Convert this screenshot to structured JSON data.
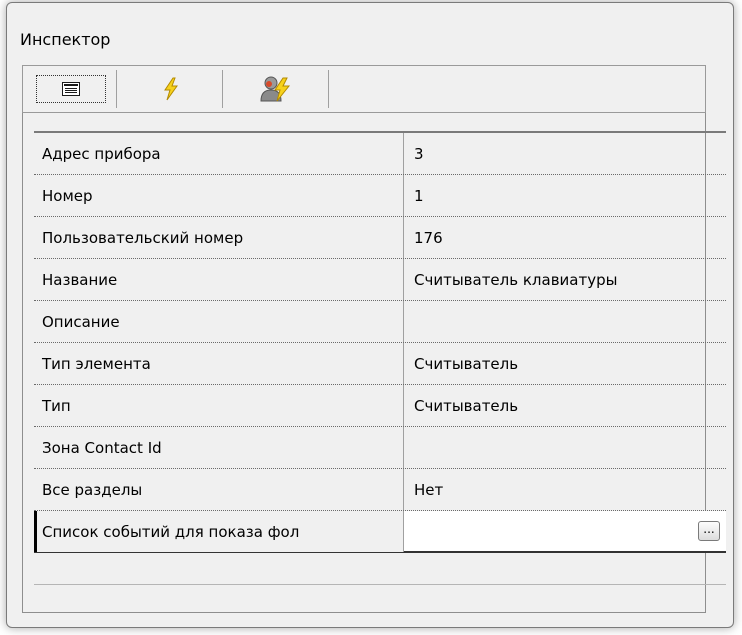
{
  "window": {
    "title": "Инспектор"
  },
  "toolbar": {
    "buttons": [
      {
        "icon": "property-list-icon"
      },
      {
        "icon": "lightning-icon"
      },
      {
        "icon": "user-lightning-icon"
      }
    ]
  },
  "properties": [
    {
      "name": "Адрес прибора",
      "value": "3"
    },
    {
      "name": "Номер",
      "value": "1"
    },
    {
      "name": "Пользовательский номер",
      "value": "176"
    },
    {
      "name": "Название",
      "value": "Считыватель клавиатуры"
    },
    {
      "name": "Описание",
      "value": ""
    },
    {
      "name": "Тип элемента",
      "value": "Считыватель"
    },
    {
      "name": "Тип",
      "value": "Считыватель"
    },
    {
      "name": "Зона Contact Id",
      "value": ""
    },
    {
      "name": "Все разделы",
      "value": "Нет"
    },
    {
      "name": "Список событий для показа фол",
      "value": "",
      "button": "..."
    }
  ]
}
